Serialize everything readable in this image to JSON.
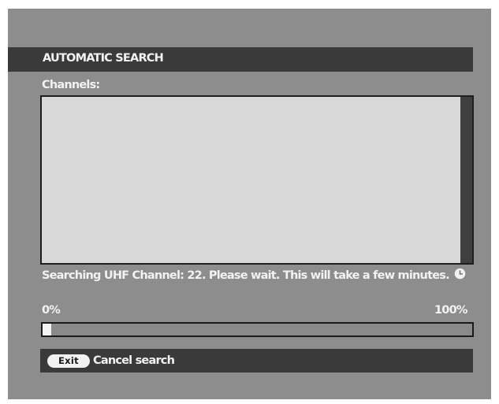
{
  "dialog": {
    "title": "AUTOMATIC SEARCH",
    "channels_label": "Channels:",
    "channel_list": [],
    "status_message": "Searching UHF Channel: 22. Please wait. This will take a few minutes.",
    "status_icon": "clock-icon"
  },
  "progress": {
    "start_label": "0%",
    "end_label": "100%",
    "fraction": 0.02
  },
  "footer": {
    "exit_key_label": "Exit",
    "cancel_label": "Cancel search"
  },
  "colors": {
    "screen_bg": "#8d8d8d",
    "bar_bg": "#3a3a3a",
    "list_bg": "#d8d8d8",
    "text": "#f2f2f2"
  }
}
